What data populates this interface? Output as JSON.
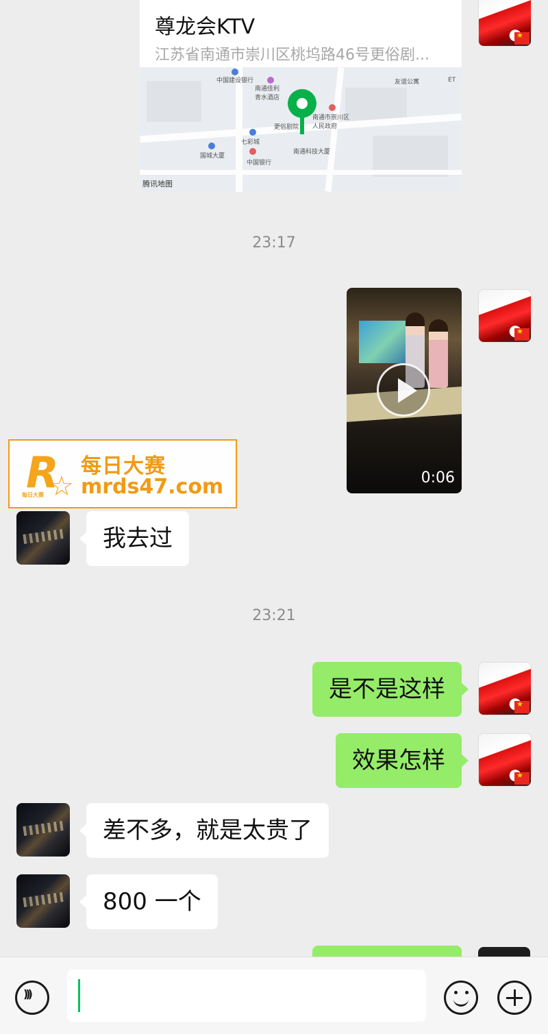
{
  "location_message": {
    "name": "尊龙会KTV",
    "address": "江苏省南通市崇川区桃坞路46号更俗剧...",
    "map_pois": [
      "中国建设银行",
      "南通佳利青水酒店",
      "南通市崇川区人民政府",
      "七彩城",
      "中国银行",
      "更俗剧院",
      "国城大厦",
      "南通科技大厦",
      "友谊公寓",
      "ET"
    ],
    "map_provider": "腾讯地图"
  },
  "timestamps": [
    "23:17",
    "23:21"
  ],
  "video_message": {
    "duration": "0:06"
  },
  "messages": [
    {
      "side": "in",
      "text": "我去过"
    },
    {
      "side": "out",
      "text": "是不是这样"
    },
    {
      "side": "out",
      "text": "效果怎样"
    },
    {
      "side": "in",
      "text": "差不多，就是太贵了"
    },
    {
      "side": "in",
      "text": "800 一个"
    }
  ],
  "watermark": {
    "logo_text": "R",
    "logo_caption": "每日大赛",
    "title": "每日大赛",
    "url": "mrds47.com",
    "color": "#f29a14"
  },
  "input_bar": {
    "text": ""
  },
  "colors": {
    "background": "#ededed",
    "outgoing_bubble": "#95ec69",
    "incoming_bubble": "#ffffff",
    "accent": "#07c160"
  }
}
